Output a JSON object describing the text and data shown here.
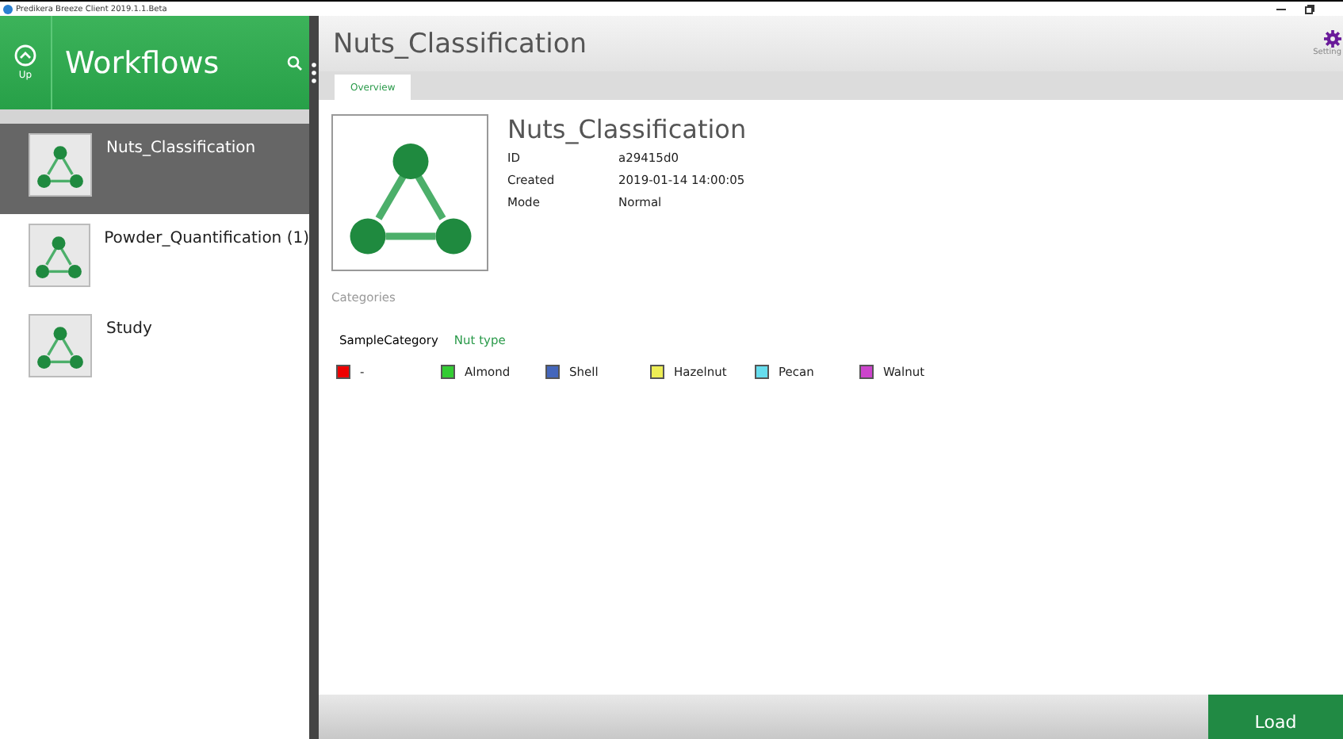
{
  "window": {
    "title": "Predikera Breeze Client 2019.1.1.Beta"
  },
  "sidebar": {
    "up_label": "Up",
    "title": "Workflows",
    "items": [
      {
        "name": "Nuts_Classification",
        "selected": true
      },
      {
        "name": "Powder_Quantification (1)",
        "selected": false
      },
      {
        "name": "Study",
        "selected": false
      }
    ]
  },
  "header": {
    "title": "Nuts_Classification",
    "settings_label": "Setting"
  },
  "tabs": [
    {
      "label": "Overview",
      "selected": true
    }
  ],
  "details": {
    "name": "Nuts_Classification",
    "fields": [
      {
        "label": "ID",
        "value": "a29415d0"
      },
      {
        "label": "Created",
        "value": "2019-01-14 14:00:05"
      },
      {
        "label": "Mode",
        "value": "Normal"
      }
    ]
  },
  "categories": {
    "heading": "Categories",
    "category": "SampleCategory",
    "type": "Nut type",
    "items": [
      {
        "label": "-",
        "color": "#ee0000"
      },
      {
        "label": "Almond",
        "color": "#33cc33"
      },
      {
        "label": "Shell",
        "color": "#4466bb"
      },
      {
        "label": "Hazelnut",
        "color": "#eeee55"
      },
      {
        "label": "Pecan",
        "color": "#66ddee"
      },
      {
        "label": "Walnut",
        "color": "#cc44cc"
      }
    ]
  },
  "load_button": "Load"
}
